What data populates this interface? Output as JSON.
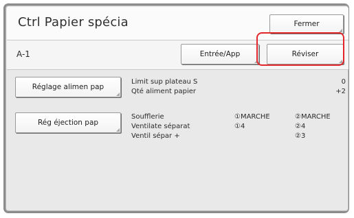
{
  "header": {
    "title": "Ctrl Papier spécia",
    "close_label": "Fermer"
  },
  "row_a1": {
    "label": "A-1",
    "entry_app_label": "Entrée/App",
    "revise_label": "Réviser"
  },
  "feed_section": {
    "button_label": "Réglage alimen pap",
    "items": [
      {
        "label": "Limit sup plateau S",
        "value": "0"
      },
      {
        "label": "Qté aliment papier",
        "value": "+2"
      }
    ]
  },
  "eject_section": {
    "button_label": "Rég éjection pap",
    "labels": [
      "Soufflerie",
      "Ventilate séparat",
      "Ventil sépar +"
    ],
    "col1": [
      "①MARCHE",
      "①4"
    ],
    "col2": [
      "②MARCHE",
      "②4",
      "②3"
    ]
  },
  "colors": {
    "highlight": "#e2252b",
    "panel": "#e9e9e9",
    "frame": "#8c8c8c"
  }
}
